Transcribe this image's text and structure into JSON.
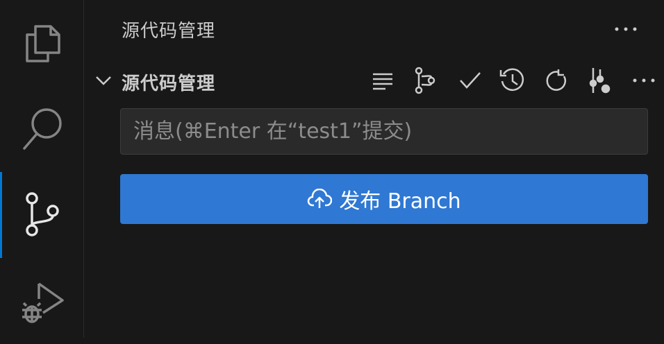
{
  "activity_bar": {
    "items": [
      {
        "icon": "files-icon"
      },
      {
        "icon": "search-icon"
      },
      {
        "icon": "source-control-icon",
        "active": true
      },
      {
        "icon": "run-debug-icon"
      }
    ],
    "accent_color": "#0078d4"
  },
  "sidebar": {
    "title": "源代码管理",
    "more_icon": "ellipsis-icon"
  },
  "section": {
    "title": "源代码管理",
    "toolbar": [
      "list-icon",
      "graph-icon",
      "check-icon",
      "history-icon",
      "refresh-icon",
      "branch-icon",
      "ellipsis-icon"
    ]
  },
  "commit": {
    "placeholder": "消息(⌘Enter 在“test1”提交)"
  },
  "publish": {
    "label": "发布 Branch",
    "icon": "cloud-upload-icon",
    "color": "#2f78d3"
  }
}
